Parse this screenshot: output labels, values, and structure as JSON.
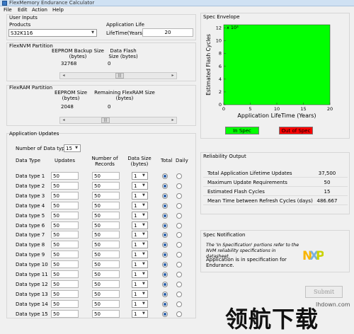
{
  "app": {
    "title": "FlexMemory Endurance Calculator"
  },
  "menu": [
    "File",
    "Edit",
    "Action",
    "Help"
  ],
  "user_inputs": {
    "title": "User Inputs",
    "products_label": "Products",
    "product_value": "S32K116",
    "app_life_label": "Application Life",
    "lifetime_label": "LifeTime(Years)",
    "lifetime_value": "20"
  },
  "flexnvm": {
    "title": "FlexNVM Partition",
    "eeprom_backup_label": "EEPROM Backup Size (bytes)",
    "eeprom_backup_value": "32768",
    "data_flash_label": "Data Flash Size (bytes)",
    "data_flash_value": "0"
  },
  "flexram": {
    "title": "FlexRAM Partition",
    "eeprom_size_label": "EEPROM Size (bytes)",
    "eeprom_size_value": "2048",
    "remaining_label": "Remaining FlexRAM Size (bytes)",
    "remaining_value": "0"
  },
  "app_updates": {
    "title": "Application Updates",
    "num_types_label": "Number of Data types",
    "num_types_value": "15",
    "headers": {
      "data_type": "Data Type",
      "updates": "Updates",
      "records": "Number of Records",
      "data_size": "Data Size (bytes)",
      "total": "Total",
      "daily": "Daily"
    },
    "rows": [
      {
        "name": "Data type 1",
        "updates": "50",
        "records": "50",
        "size": "1"
      },
      {
        "name": "Data type 2",
        "updates": "50",
        "records": "50",
        "size": "1"
      },
      {
        "name": "Data type 3",
        "updates": "50",
        "records": "50",
        "size": "1"
      },
      {
        "name": "Data type 4",
        "updates": "50",
        "records": "50",
        "size": "1"
      },
      {
        "name": "Data type 5",
        "updates": "50",
        "records": "50",
        "size": "1"
      },
      {
        "name": "Data type 6",
        "updates": "50",
        "records": "50",
        "size": "1"
      },
      {
        "name": "Data type 7",
        "updates": "50",
        "records": "50",
        "size": "1"
      },
      {
        "name": "Data type 8",
        "updates": "50",
        "records": "50",
        "size": "1"
      },
      {
        "name": "Data type 9",
        "updates": "50",
        "records": "50",
        "size": "1"
      },
      {
        "name": "Data type 10",
        "updates": "50",
        "records": "50",
        "size": "1"
      },
      {
        "name": "Data type 11",
        "updates": "50",
        "records": "50",
        "size": "1"
      },
      {
        "name": "Data type 12",
        "updates": "50",
        "records": "50",
        "size": "1"
      },
      {
        "name": "Data type 13",
        "updates": "50",
        "records": "50",
        "size": "1"
      },
      {
        "name": "Data type 14",
        "updates": "50",
        "records": "50",
        "size": "1"
      },
      {
        "name": "Data type 15",
        "updates": "50",
        "records": "50",
        "size": "1"
      }
    ]
  },
  "spec_envelope": {
    "title": "Spec Envelope",
    "in_spec_label": "In Spec",
    "out_spec_label": "Out of Spec",
    "in_spec_color": "#00ff00",
    "out_spec_color": "#ff0000"
  },
  "chart_data": {
    "type": "area",
    "xlabel": "Application LifeTime (Years)",
    "ylabel": "Estimated Flash Cycles",
    "y_multiplier": "x 10³",
    "xlim": [
      0,
      20
    ],
    "ylim": [
      0,
      12.5
    ],
    "x_ticks": [
      0,
      5,
      10,
      15,
      20
    ],
    "y_ticks": [
      0,
      2,
      4,
      6,
      8,
      10,
      12
    ],
    "series": [
      {
        "x": [
          0,
          20
        ],
        "y": [
          12.5,
          12.5
        ],
        "color": "#00ff00"
      }
    ],
    "grid": false
  },
  "reliability": {
    "title": "Reliability Output",
    "rows": [
      {
        "label": "Total Application Lifetime Updates",
        "value": "37,500"
      },
      {
        "label": "Maximum Update Requirements",
        "value": "50"
      },
      {
        "label": "Estimated Flash Cycles",
        "value": "15"
      },
      {
        "label": "Mean Time between Refresh Cycles (days)",
        "value": "486.667"
      }
    ]
  },
  "spec_notification": {
    "title": "Spec Notification",
    "note": "The 'In Specification' portions refer to the NVM reliability specifications in datasheet.",
    "status": "Application is in specification for Endurance.",
    "logo_text": "NXP",
    "logo_colors": {
      "n": "#f9b500",
      "x": "#7bb1db",
      "p": "#c9d200"
    }
  },
  "submit_label": "Submit",
  "watermark": {
    "text": "领航下载",
    "url": "lhdown.com"
  }
}
